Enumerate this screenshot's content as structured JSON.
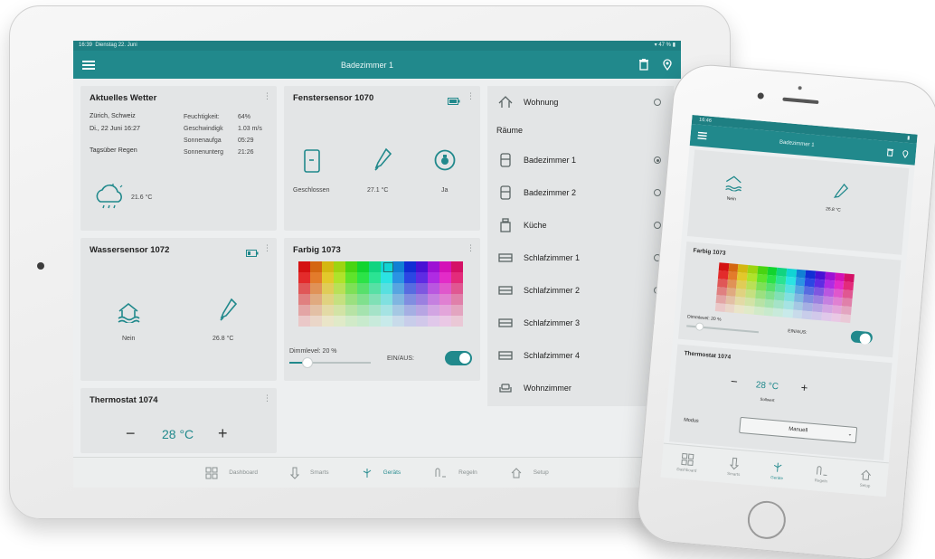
{
  "tablet": {
    "status": {
      "time": "16:39",
      "date": "Dienstag 22. Juni",
      "battery": "47 %"
    },
    "appbar": {
      "title": "Badezimmer 1"
    },
    "weather": {
      "title": "Aktuelles Wetter",
      "location": "Zürich, Schweiz",
      "datetime": "Di., 22 Juni 16:27",
      "forecast": "Tagsüber Regen",
      "temperature": "21.6 °C",
      "rows": [
        {
          "label": "Feuchtigkeit:",
          "value": "64%"
        },
        {
          "label": "Geschwindigk",
          "value": "1.03 m/s"
        },
        {
          "label": "Sonnenaufga",
          "value": "05:29"
        },
        {
          "label": "Sonnenunterg",
          "value": "21:26"
        }
      ]
    },
    "window_sensor": {
      "title": "Fenstersensor 1070",
      "state_label": "Geschlossen",
      "temperature": "27.1 °C",
      "alarm_label": "Ja"
    },
    "water_sensor": {
      "title": "Wassersensor 1072",
      "flood_label": "Nein",
      "temperature": "26.8 °C"
    },
    "color_card": {
      "title": "Farbig 1073",
      "dimm_label": "Dimmlevel: 20 %",
      "dimm_level": 0.2,
      "onoff_label": "EIN/AUS:"
    },
    "thermostat": {
      "title": "Thermostat 1074",
      "minus": "−",
      "value": "28 °C",
      "plus": "+"
    },
    "rooms": {
      "top": {
        "label": "Wohnung"
      },
      "section_label": "Räume",
      "items": [
        {
          "label": "Badezimmer 1",
          "selected": true
        },
        {
          "label": "Badezimmer 2",
          "selected": false
        },
        {
          "label": "Küche",
          "selected": false
        },
        {
          "label": "Schlafzimmer 1",
          "selected": false
        },
        {
          "label": "Schlafzimmer 2",
          "selected": false
        },
        {
          "label": "Schlafzimmer 3",
          "selected": false
        },
        {
          "label": "Schlafzimmer 4",
          "selected": false
        },
        {
          "label": "Wohnzimmer",
          "selected": false
        }
      ]
    },
    "nav": [
      {
        "label": "Dashboard",
        "icon": "dashboard-icon",
        "active": false
      },
      {
        "label": "Smarts",
        "icon": "smarts-icon",
        "active": false
      },
      {
        "label": "Geräts",
        "icon": "devices-icon",
        "active": true
      },
      {
        "label": "Regeln",
        "icon": "rules-icon",
        "active": false
      },
      {
        "label": "Setup",
        "icon": "setup-icon",
        "active": false
      }
    ]
  },
  "phone": {
    "status": {
      "time": "16:46"
    },
    "appbar": {
      "title": "Badezimmer 1"
    },
    "sensor": {
      "flood_label": "Nein",
      "temperature": "26.8 °C"
    },
    "color_card": {
      "title": "Farbig 1073",
      "dimm_label": "Dimmlevel: 20 %",
      "onoff_label": "EIN/AUS:"
    },
    "thermostat": {
      "title": "Thermostat 1074",
      "minus": "−",
      "value": "28 °C",
      "plus": "+",
      "sublabel": "Sollwert"
    },
    "mode": {
      "label": "Modus",
      "value": "Manuell"
    },
    "nav": [
      {
        "label": "Dashboard",
        "active": false
      },
      {
        "label": "Smarts",
        "active": false
      },
      {
        "label": "Geräte",
        "active": true
      },
      {
        "label": "Regeln",
        "active": false
      },
      {
        "label": "Setup",
        "active": false
      }
    ]
  },
  "colors": {
    "accent": "#21898c",
    "statusbar": "#1e7f82",
    "card": "#e3e5e6",
    "background": "#edeff0"
  }
}
